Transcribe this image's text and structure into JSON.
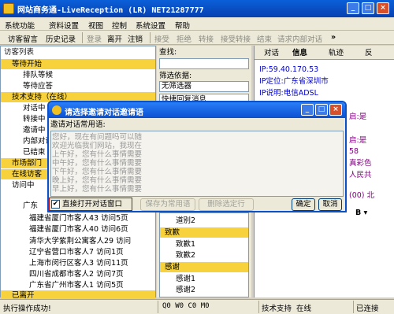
{
  "window": {
    "title": "网站商务通-LiveReception (LR)  NET21287777",
    "minimize": "_",
    "maximize": "□",
    "close": "×"
  },
  "menu": [
    "系统功能",
    "资料设置",
    "视图",
    "控制",
    "系统设置",
    "帮助"
  ],
  "toolbar": {
    "items": [
      "访客留言",
      "历史记录",
      "登录",
      "离开",
      "注销",
      "接受",
      "拒绝",
      "转接",
      "接受转接",
      "结束",
      "请求内部对话"
    ],
    "more": "»"
  },
  "left": {
    "header": "访客列表",
    "rows": [
      "等待开始",
      "排队等候",
      "等待应答",
      "技术支持（在线）",
      "对话中",
      "转接中",
      "邀请中",
      "内部对话",
      "已结束",
      "市场部门",
      "在线访客",
      "访问中",
      "广东",
      "福建省厦门市客人43 访问5页",
      "福建省厦门市客人40 访问6页",
      "清华大学紫荆公寓客人29 访问",
      "辽宁省营口市客人7 访问1页",
      "上海市闵行区客人3 访问11页",
      "四川省成都市客人2 访问7页",
      "广东省广州市客人1 访问5页",
      "已离开"
    ]
  },
  "mid": {
    "search_label": "查找:",
    "filter_label": "筛选依据:",
    "filter_value": "无筛选器",
    "section_label": "快捷回复消息",
    "items": [
      "道别2",
      "致歉",
      "致歉1",
      "致歉2",
      "感谢",
      "感谢1",
      "感谢2"
    ]
  },
  "right": {
    "tabs": [
      "对话",
      "信息",
      "轨迹",
      "反"
    ],
    "info": [
      "IP:59.40.170.53",
      "IP定位:广东省深圳市",
      "IP说明:电信ADSL"
    ],
    "chat": [
      "启:是",
      "启:是",
      "58",
      "真彩色",
      "人民共",
      "(00) 北"
    ],
    "fmt": "B ▾"
  },
  "dialog": {
    "title": "请选择邀请对话邀请语",
    "label": "邀请对话常用语:",
    "lines": [
      "您好，现在有问题吗可以随",
      "欢迎光临我们网站，我现在",
      "上午好，您有什么事情需要",
      "中午好，您有什么事情需要",
      "下午好，您有什么事情需要",
      "晚上好，您有什么事情需要",
      "早上好，您有什么事情需要"
    ],
    "checkbox": "直接打开对话窗口",
    "checked": true,
    "save": "保存为常用语",
    "delete": "删除选定行",
    "ok": "确定",
    "cancel": "取消",
    "min": "_",
    "max": "□",
    "close": "×"
  },
  "status": {
    "message": "执行操作成功!",
    "counters": "Q0 W0 C0 M0",
    "dept": "技术支持",
    "state": "在线",
    "connection": "已连接"
  },
  "colors": {
    "title": "#0a50c8",
    "section": "#f7d23c",
    "info": "#0000cc"
  }
}
